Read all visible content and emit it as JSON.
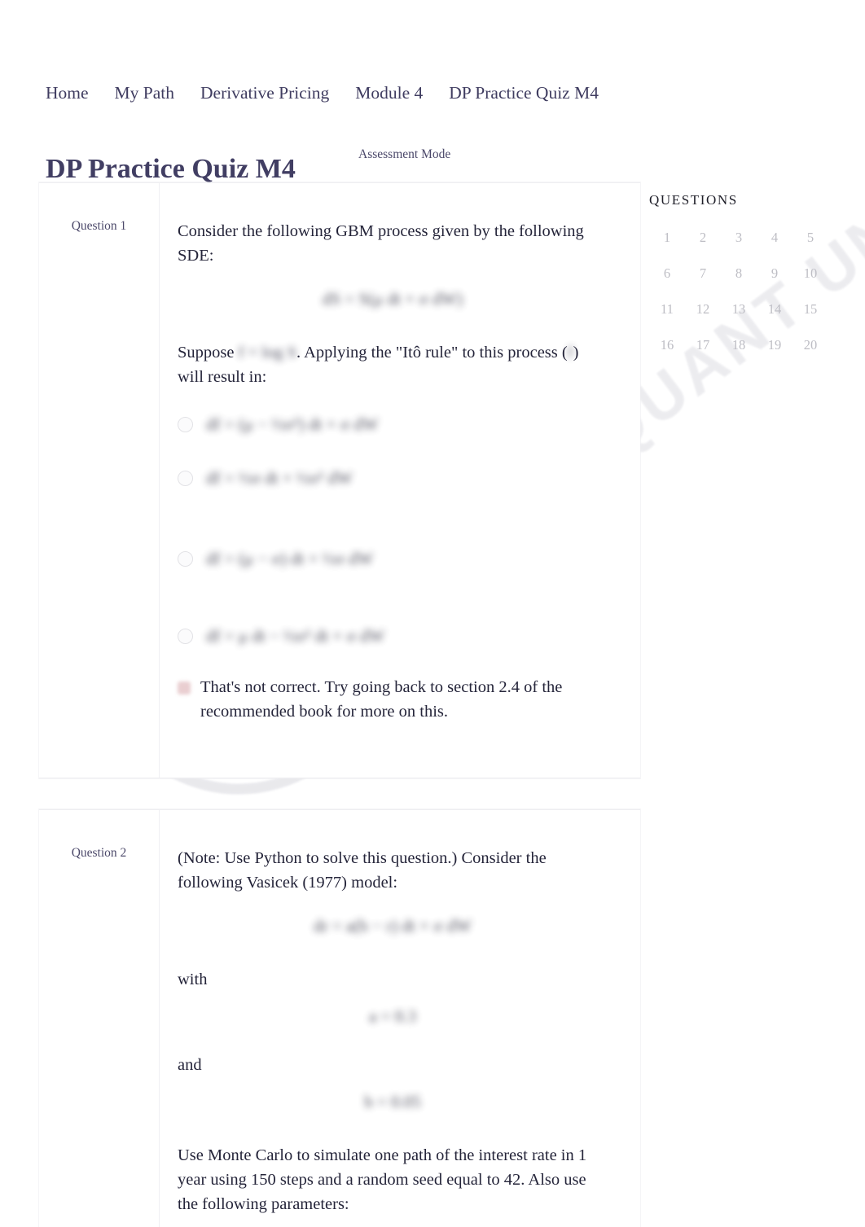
{
  "breadcrumb": {
    "items": [
      {
        "label": "Home"
      },
      {
        "label": "My Path"
      },
      {
        "label": "Derivative Pricing"
      },
      {
        "label": "Module 4"
      },
      {
        "label": "DP Practice Quiz M4"
      }
    ]
  },
  "header": {
    "title": "DP Practice Quiz M4",
    "mode_label": "Assessment Mode"
  },
  "questions_panel": {
    "heading": "QUESTIONS",
    "numbers": [
      "1",
      "2",
      "3",
      "4",
      "5",
      "6",
      "7",
      "8",
      "9",
      "10",
      "11",
      "12",
      "13",
      "14",
      "15",
      "16",
      "17",
      "18",
      "19",
      "20"
    ]
  },
  "watermark": {
    "text": "WORLDQUANT UNIVERSITY",
    "mark_name": "spiral-logo"
  },
  "question1": {
    "label": "Question 1",
    "paragraph1": "Consider the following GBM process given by the following SDE:",
    "formula1": "dS = S(μ dt + σ dW)",
    "paragraph2_before": "Suppose",
    "inline_formula": "f = log S",
    "paragraph2_middle": ". Applying the \"Itô rule\" to this process (",
    "inline_formula2": "f",
    "paragraph2_after": ") will result in:",
    "options": [
      {
        "id": "opt-a",
        "formula": "df = (μ − ½σ²) dt + σ dW",
        "selected": false
      },
      {
        "id": "opt-b",
        "formula": "df = ½σ dt + ½σ² dW",
        "selected": false
      },
      {
        "id": "opt-c",
        "formula": "df = (μ − σ) dt + ½σ dW",
        "selected": false
      },
      {
        "id": "opt-d",
        "formula": "df = μ dt − ½σ² dt + σ dW",
        "selected": false
      }
    ],
    "feedback": "That's not correct. Try going back to section 2.4 of the recommended book for more on this.",
    "feedback_icon": "incorrect-icon"
  },
  "question2": {
    "label": "Question 2",
    "paragraph1": "(Note:  Use Python to solve this question.) Consider the following Vasicek (1977) model:",
    "formula1": "dr = a(b − r) dt + σ dW",
    "with_label": "with",
    "formula2": "a = 0.3",
    "and_label": "and",
    "formula3": "b = 0.05",
    "paragraph2": "Use Monte Carlo to simulate one path of the interest rate in 1 year using 150 steps and a random seed equal to 42. Also use the following parameters:"
  },
  "colors": {
    "title": "#413e63",
    "breadcrumb": "#3f3c60",
    "body_text": "#25253a",
    "question_label": "#4d4a6b",
    "question_number": "#bdbdc4",
    "card_border": "#eeeef1",
    "feedback_icon": "#d8a7ab"
  }
}
